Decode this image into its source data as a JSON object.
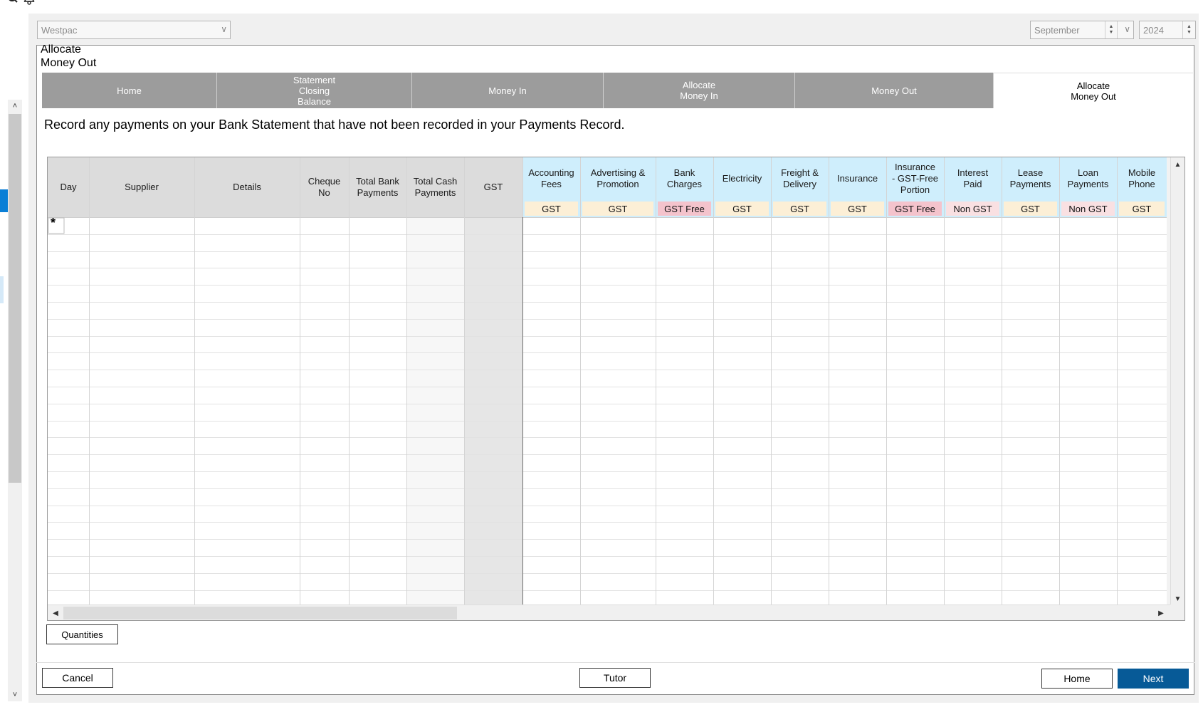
{
  "icons": {
    "search": "search-icon",
    "bell": "bell-icon"
  },
  "header": {
    "bank_combo": "Westpac",
    "month_combo": "September",
    "year_combo": "2024"
  },
  "panel": {
    "title_line1": "Allocate",
    "title_line2": "Money Out"
  },
  "tabs": [
    {
      "label": "Home"
    },
    {
      "label": "Statement\nClosing\nBalance"
    },
    {
      "label": "Money In"
    },
    {
      "label": "Allocate\nMoney In"
    },
    {
      "label": "Money Out"
    },
    {
      "label": "Allocate\nMoney Out",
      "active": true
    }
  ],
  "instruction": "Record any payments on your Bank Statement that have not been recorded in your Payments Record.",
  "grid": {
    "new_row_marker": "*",
    "columns": [
      {
        "label": "Day",
        "tag": ""
      },
      {
        "label": "Supplier",
        "tag": ""
      },
      {
        "label": "Details",
        "tag": ""
      },
      {
        "label": "Cheque\nNo",
        "tag": ""
      },
      {
        "label": "Total Bank\nPayments",
        "tag": ""
      },
      {
        "label": "Total Cash\nPayments",
        "tag": ""
      },
      {
        "label": "GST",
        "tag": ""
      },
      {
        "label": "Accounting\nFees",
        "tag": "GST"
      },
      {
        "label": "Advertising &\nPromotion",
        "tag": "GST"
      },
      {
        "label": "Bank\nCharges",
        "tag": "GST Free"
      },
      {
        "label": "Electricity",
        "tag": "GST"
      },
      {
        "label": "Freight &\nDelivery",
        "tag": "GST"
      },
      {
        "label": "Insurance",
        "tag": "GST"
      },
      {
        "label": "Insurance\n- GST-Free\nPortion",
        "tag": "GST Free"
      },
      {
        "label": "Interest\nPaid",
        "tag": "Non GST"
      },
      {
        "label": "Lease\nPayments",
        "tag": "GST"
      },
      {
        "label": "Loan\nPayments",
        "tag": "Non GST"
      },
      {
        "label": "Mobile\nPhone",
        "tag": "GST"
      }
    ],
    "colors": {
      "fixed_header": "#dcdcdc",
      "account_header": "#cfeefc",
      "tag_gst": "#fcefd6",
      "tag_free": "#f4c3cc",
      "tag_nongst": "#f9e0e2",
      "gst_col": "#e6e6e6",
      "cash_col": "#f7f7f7"
    }
  },
  "buttons": {
    "quantities": "Quantities",
    "cancel": "Cancel",
    "tutor": "Tutor",
    "home": "Home",
    "next": "Next"
  }
}
